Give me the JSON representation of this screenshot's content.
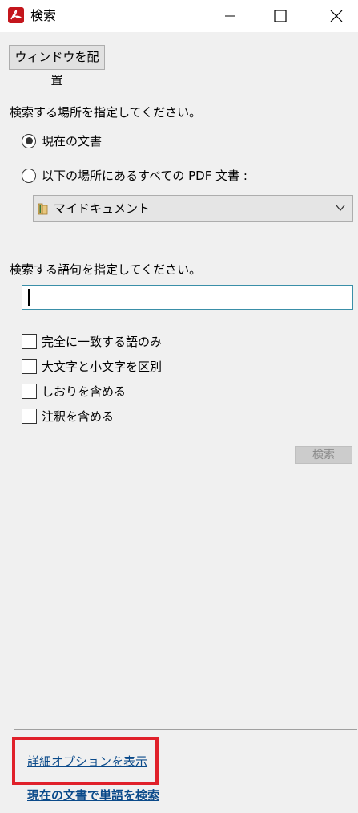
{
  "window": {
    "title": "検索",
    "app_icon": "acrobat-icon",
    "controls": [
      "minimize-icon",
      "maximize-icon",
      "close-icon"
    ]
  },
  "toolbar": {
    "arrange_window_label": "ウィンドウを配置"
  },
  "location": {
    "prompt": "検索する場所を指定してください。",
    "options": [
      {
        "label": "現在の文書",
        "selected": true
      },
      {
        "label": "以下の場所にあるすべての PDF 文書 :",
        "selected": false
      }
    ],
    "folder_dropdown": {
      "selected": "マイドキュメント",
      "icon": "folder-icon"
    }
  },
  "term": {
    "prompt": "検索する語句を指定してください。",
    "value": ""
  },
  "options": [
    {
      "label": "完全に一致する語のみ",
      "checked": false
    },
    {
      "label": "大文字と小文字を区別",
      "checked": false
    },
    {
      "label": "しおりを含める",
      "checked": false
    },
    {
      "label": "注釈を含める",
      "checked": false
    }
  ],
  "search_button_label": "検索",
  "footer": {
    "advanced_options_link": "詳細オプションを表示",
    "find_word_link": "現在の文書で単語を検索"
  },
  "colors": {
    "highlight": "#e0202a",
    "link": "#0a4a8a",
    "acrobat_red": "#c4161c"
  }
}
